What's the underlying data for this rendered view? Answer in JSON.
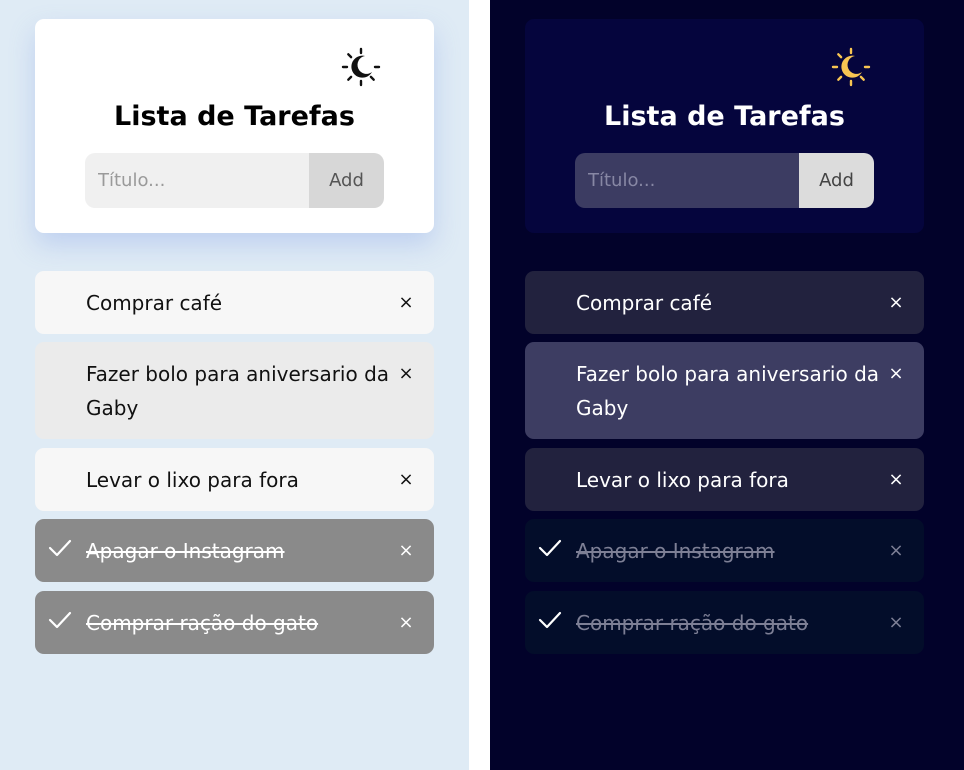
{
  "colors": {
    "light_background": "#dfebf5",
    "dark_background": "#02022a",
    "sun_icon_dark_theme": "#f7c552"
  },
  "panels": [
    {
      "theme": "light",
      "title": "Lista de Tarefas",
      "toggle_icon": "moon-sun-icon",
      "input": {
        "placeholder": "Título...",
        "value": ""
      },
      "add_label": "Add",
      "tasks": [
        {
          "text": "Comprar café",
          "done": false,
          "delete_label": "×"
        },
        {
          "text": "Fazer bolo para aniversario da Gaby",
          "done": false,
          "delete_label": "×"
        },
        {
          "text": "Levar o lixo para fora",
          "done": false,
          "delete_label": "×"
        },
        {
          "text": "Apagar o Instagram",
          "done": true,
          "delete_label": "×"
        },
        {
          "text": "Comprar ração do gato",
          "done": true,
          "delete_label": "×"
        }
      ]
    },
    {
      "theme": "dark",
      "title": "Lista de Tarefas",
      "toggle_icon": "moon-sun-icon",
      "input": {
        "placeholder": "Título...",
        "value": ""
      },
      "add_label": "Add",
      "tasks": [
        {
          "text": "Comprar café",
          "done": false,
          "delete_label": "×"
        },
        {
          "text": "Fazer bolo para aniversario da Gaby",
          "done": false,
          "delete_label": "×"
        },
        {
          "text": "Levar o lixo para fora",
          "done": false,
          "delete_label": "×"
        },
        {
          "text": "Apagar o Instagram",
          "done": true,
          "delete_label": "×"
        },
        {
          "text": "Comprar ração do gato",
          "done": true,
          "delete_label": "×"
        }
      ]
    }
  ]
}
